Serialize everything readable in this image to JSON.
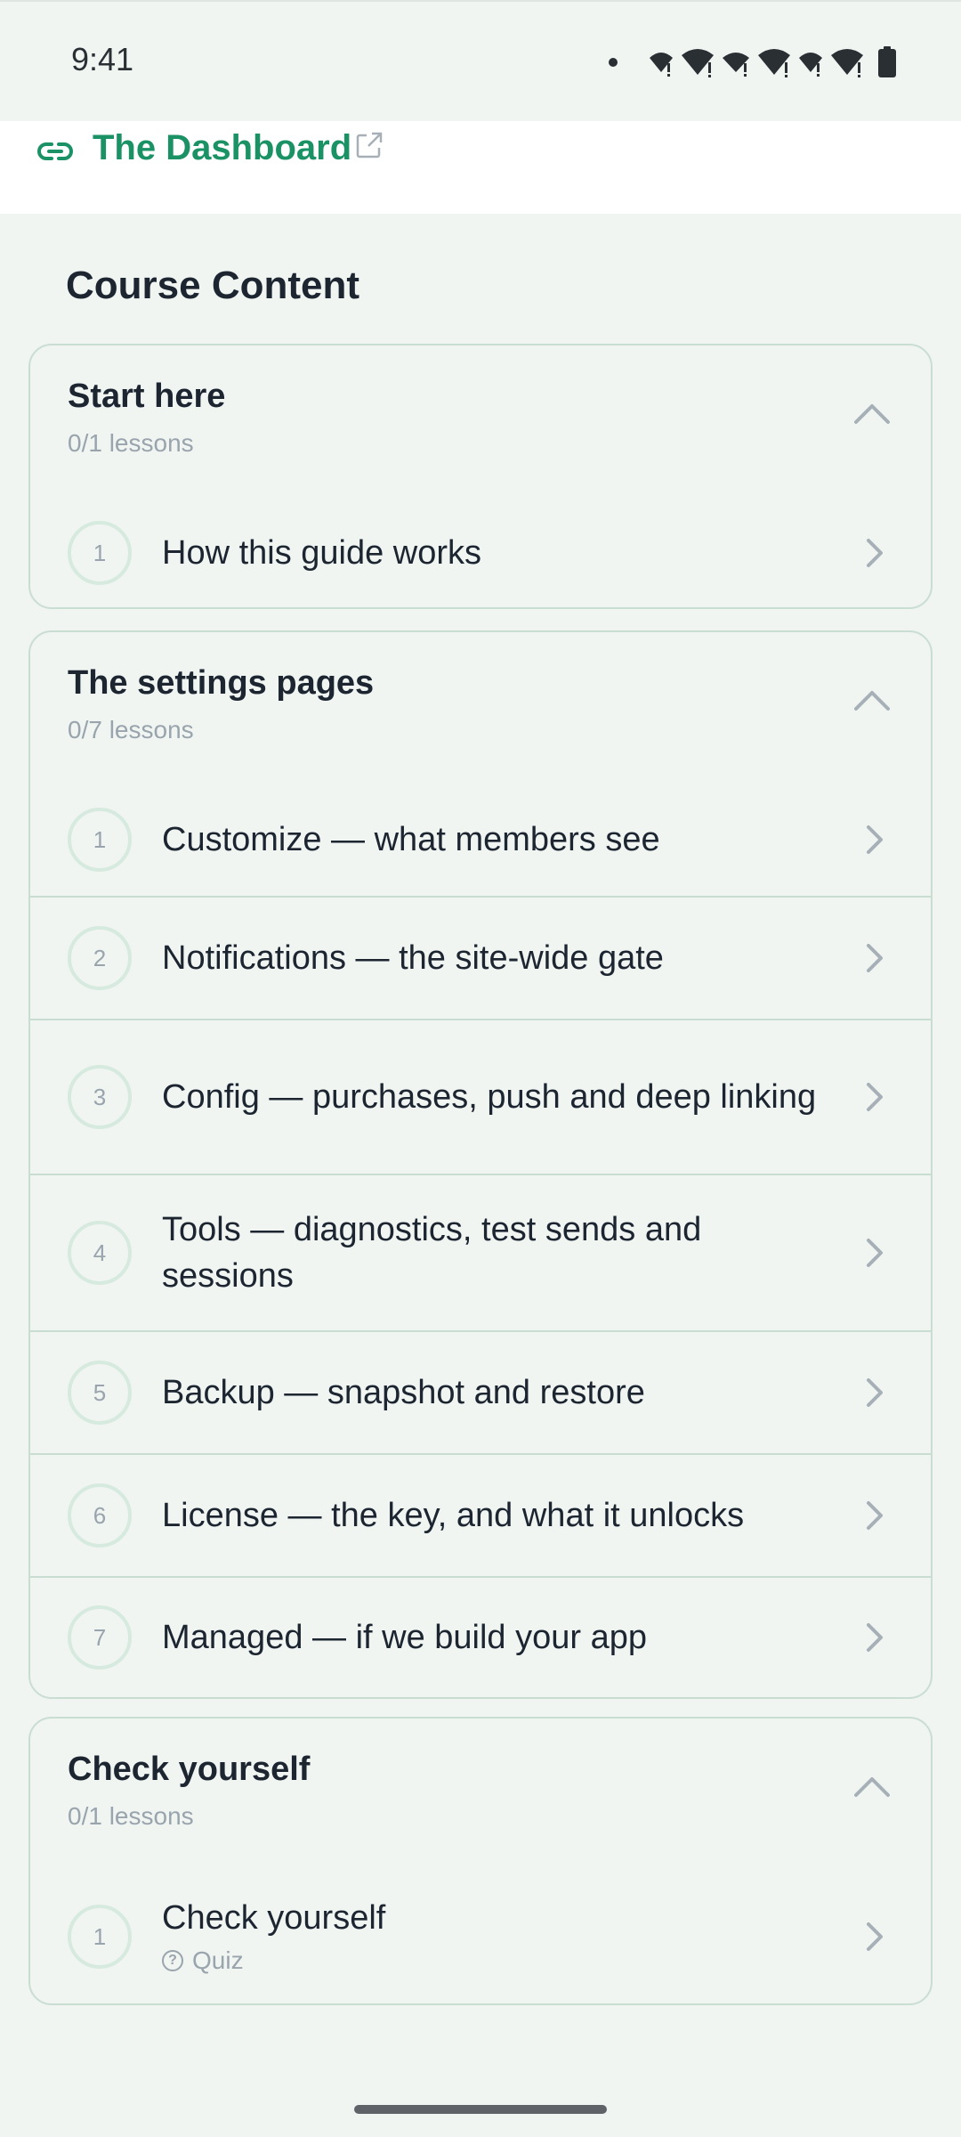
{
  "status_bar": {
    "time": "9:41",
    "icons": [
      "notification-dot-icon",
      "wifi-alert-icon",
      "wifi-alert-icon",
      "wifi-alert-icon",
      "wifi-alert-icon",
      "wifi-alert-icon",
      "wifi-alert-icon",
      "battery-icon"
    ]
  },
  "top_link": {
    "label": "The Dashboard",
    "icon": "link-icon",
    "external_icon": "external-link-icon"
  },
  "section": {
    "title": "Course Content"
  },
  "modules": [
    {
      "title": "Start here",
      "count": "0/1 lessons",
      "expanded": true,
      "lessons": [
        {
          "number": "1",
          "title": "How this guide works"
        }
      ]
    },
    {
      "title": "The settings pages",
      "count": "0/7 lessons",
      "expanded": true,
      "lessons": [
        {
          "number": "1",
          "title": "Customize — what members see"
        },
        {
          "number": "2",
          "title": "Notifications — the site-wide gate"
        },
        {
          "number": "3",
          "title": "Config — purchases, push and deep linking"
        },
        {
          "number": "4",
          "title": "Tools — diagnostics, test sends and sessions"
        },
        {
          "number": "5",
          "title": "Backup — snapshot and restore"
        },
        {
          "number": "6",
          "title": "License — the key, and what it unlocks"
        },
        {
          "number": "7",
          "title": "Managed — if we build your app"
        }
      ]
    },
    {
      "title": "Check yourself",
      "count": "0/1 lessons",
      "expanded": true,
      "lessons": [
        {
          "number": "1",
          "title": "Check yourself",
          "tag": "Quiz",
          "tag_icon": "question-circle-icon"
        }
      ]
    }
  ],
  "colors": {
    "background": "#f0f5f2",
    "accent_green": "#1b9266",
    "card_border": "#c9ddd3",
    "muted_text": "#9aa4ac",
    "primary_text": "#1c2530"
  }
}
